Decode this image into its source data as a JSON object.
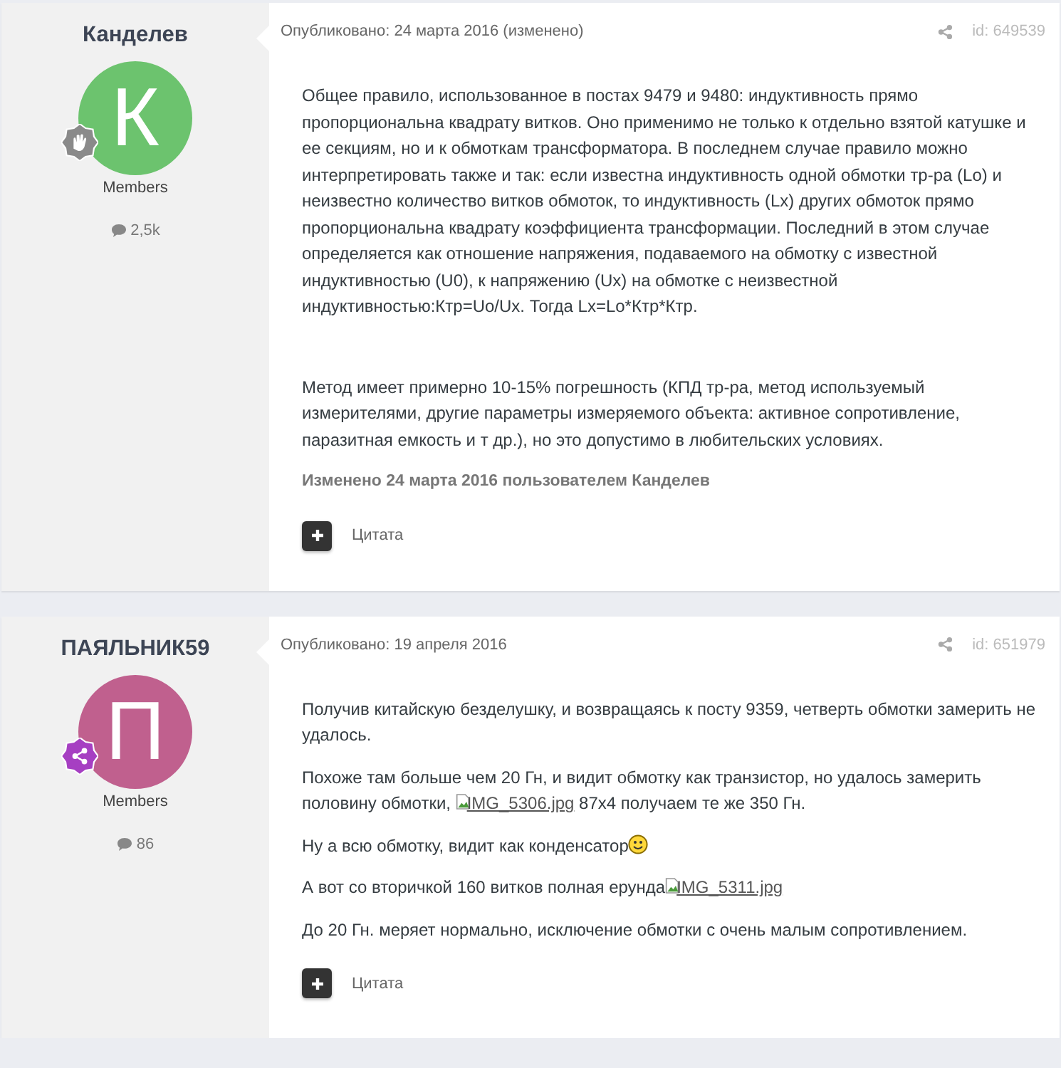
{
  "posts": [
    {
      "author": {
        "name": "Канделев",
        "avatar_letter": "К",
        "color": "#6cc36e",
        "badge": {
          "kind": "hand"
        },
        "group": "Members",
        "post_count": "2,5k"
      },
      "posted": "Опубликовано: 24 марта 2016 (изменено)",
      "post_id": "id: 649539",
      "gap_after_first": true,
      "paragraphs": [
        [
          {
            "kind": "text",
            "text": "Общее правило, использованное в постах 9479 и 9480: индуктивность прямо пропорциональна квадрату витков. Оно применимо не только к отдельно взятой катушке и ее секциям, но и к обмоткам трансформатора. В последнем случае правило можно интерпретировать также и так: если известна индуктивность одной обмотки тр-ра (Lo) и неизвестно количество витков обмоток, то индуктивность (Lx) других обмоток прямо пропорциональна квадрату коэффициента трансформации. Последний в этом случае определяется как отношение напряжения, подаваемого на обмотку с известной индуктивностью (U0), к напряжению (Ux) на обмотке с неизвестной индуктивностью:Ктр=Uo/Ux. Тогда Lx=Lo*Ктр*Ктр."
          }
        ],
        [
          {
            "kind": "text",
            "text": "Метод имеет примерно 10-15% погрешность (КПД тр-ра, метод используемый измерителями, другие параметры измеряемого объекта: активное сопротивление, паразитная емкость и т др.), но это допустимо в любительских условиях."
          }
        ]
      ],
      "edited_note": "Изменено 24 марта 2016 пользователем Канделев",
      "quote_label": "Цитата"
    },
    {
      "author": {
        "name": "ПАЯЛЬНИК59",
        "avatar_letter": "П",
        "color": "#c0608e",
        "badge": {
          "kind": "share"
        },
        "group": "Members",
        "post_count": "86"
      },
      "posted": "Опубликовано: 19 апреля 2016",
      "post_id": "id: 651979",
      "gap_after_first": false,
      "paragraphs": [
        [
          {
            "kind": "text",
            "text": "Получив китайскую безделушку, и возвращаясь к посту 9359, четверть обмотки замерить не удалось."
          }
        ],
        [
          {
            "kind": "text",
            "text": "Похоже там больше чем 20 Гн, и видит обмотку как транзистор, но удалось замерить половину обмотки, "
          },
          {
            "kind": "image_link",
            "text": "IMG_5306.jpg"
          },
          {
            "kind": "text",
            "text": " 87x4 получаем те же 350 Гн."
          }
        ],
        [
          {
            "kind": "text",
            "text": "Ну а всю обмотку, видит как конденсатор"
          },
          {
            "kind": "emoji"
          }
        ],
        [
          {
            "kind": "text",
            "text": "А вот со вторичкой 160 витков полная ерунда"
          },
          {
            "kind": "image_link",
            "text": "IMG_5311.jpg"
          }
        ],
        [
          {
            "kind": "text",
            "text": "До 20 Гн. меряет нормально, исключение обмотки с очень малым сопротивлением."
          }
        ]
      ],
      "quote_label": "Цитата"
    }
  ]
}
